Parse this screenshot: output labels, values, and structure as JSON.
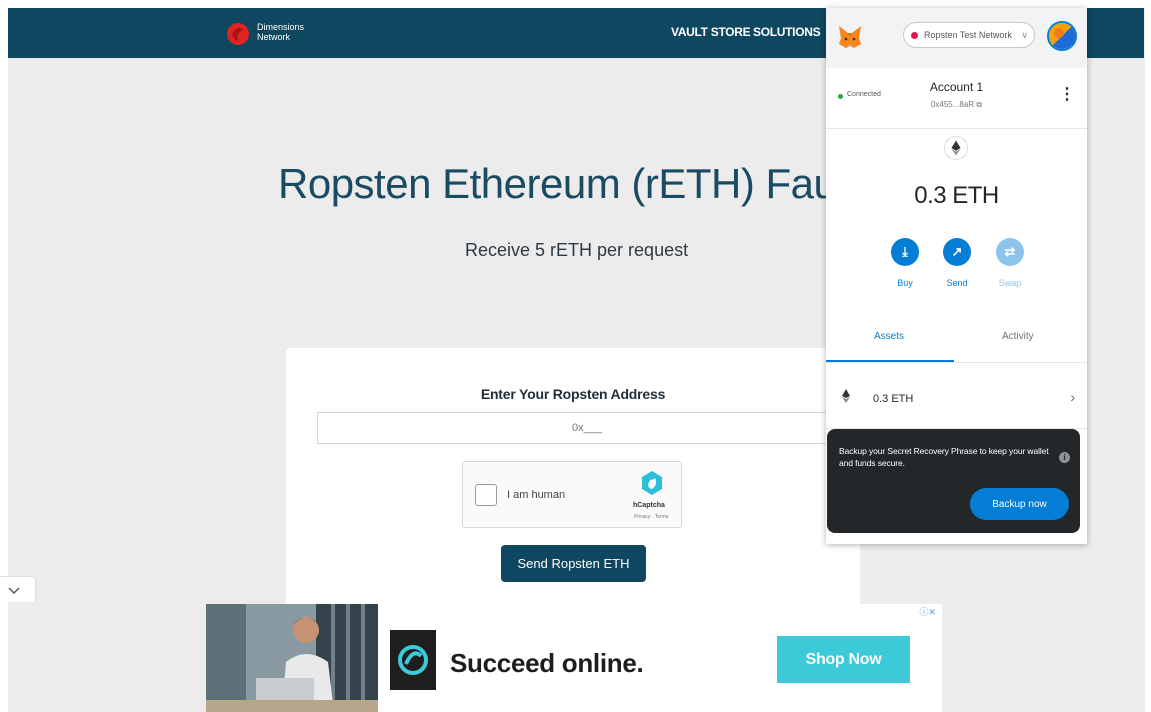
{
  "site": {
    "brand_line1": "Dimensions",
    "brand_line2": "Network",
    "nav": [
      "VAULT STORE",
      "SOLUTIONS"
    ],
    "title": "Ropsten Ethereum (rETH) Fauc",
    "subtitle": "Receive 5 rETH per request"
  },
  "faucet": {
    "address_label": "Enter Your Ropsten Address",
    "address_placeholder": "0x___",
    "captcha_label": "I am human",
    "captcha_brand": "hCaptcha",
    "captcha_links": "Privacy · Terms",
    "send_button": "Send Ropsten ETH"
  },
  "ad": {
    "headline": "Succeed online.",
    "cta": "Shop Now",
    "choices": "ⓘ✕"
  },
  "metamask": {
    "network": "Ropsten Test Network",
    "status": "Connected",
    "account_name": "Account 1",
    "account_address": "0x455...8aR",
    "balance": "0.3 ETH",
    "actions": [
      "Buy",
      "Send",
      "Swap"
    ],
    "tabs": [
      "Assets",
      "Activity"
    ],
    "asset": "0.3 ETH",
    "popover_text": "Backup your Secret Recovery Phrase to keep your wallet and funds secure.",
    "popover_button": "Backup now",
    "colors": {
      "accent": "#037dd6",
      "network_dot": "#e91550",
      "connected": "#28a745"
    }
  },
  "colors": {
    "header": "#0f4760",
    "background": "#ececec",
    "ad_cta": "#3cc9d8"
  }
}
